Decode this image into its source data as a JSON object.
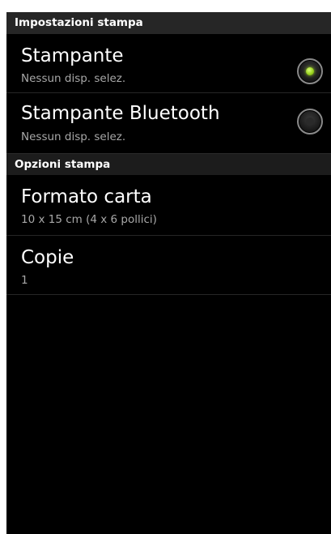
{
  "sections": [
    {
      "header": "Impostazioni stampa",
      "items": [
        {
          "title": "Stampante",
          "subtitle": "Nessun disp. selez.",
          "radio": "selected"
        },
        {
          "title": "Stampante Bluetooth",
          "subtitle": "Nessun disp. selez.",
          "radio": "unselected"
        }
      ]
    },
    {
      "header": "Opzioni stampa",
      "items": [
        {
          "title": "Formato carta",
          "subtitle": "10 x 15 cm (4 x 6 pollici)"
        },
        {
          "title": "Copie",
          "subtitle": "1"
        }
      ]
    }
  ],
  "colors": {
    "background": "#000000",
    "header_background": "#262626",
    "radio_active": "#9ad31e",
    "subtitle": "#a8a8a8"
  },
  "icons": {
    "radio_selected": "radio-selected-icon",
    "radio_unselected": "radio-unselected-icon"
  }
}
